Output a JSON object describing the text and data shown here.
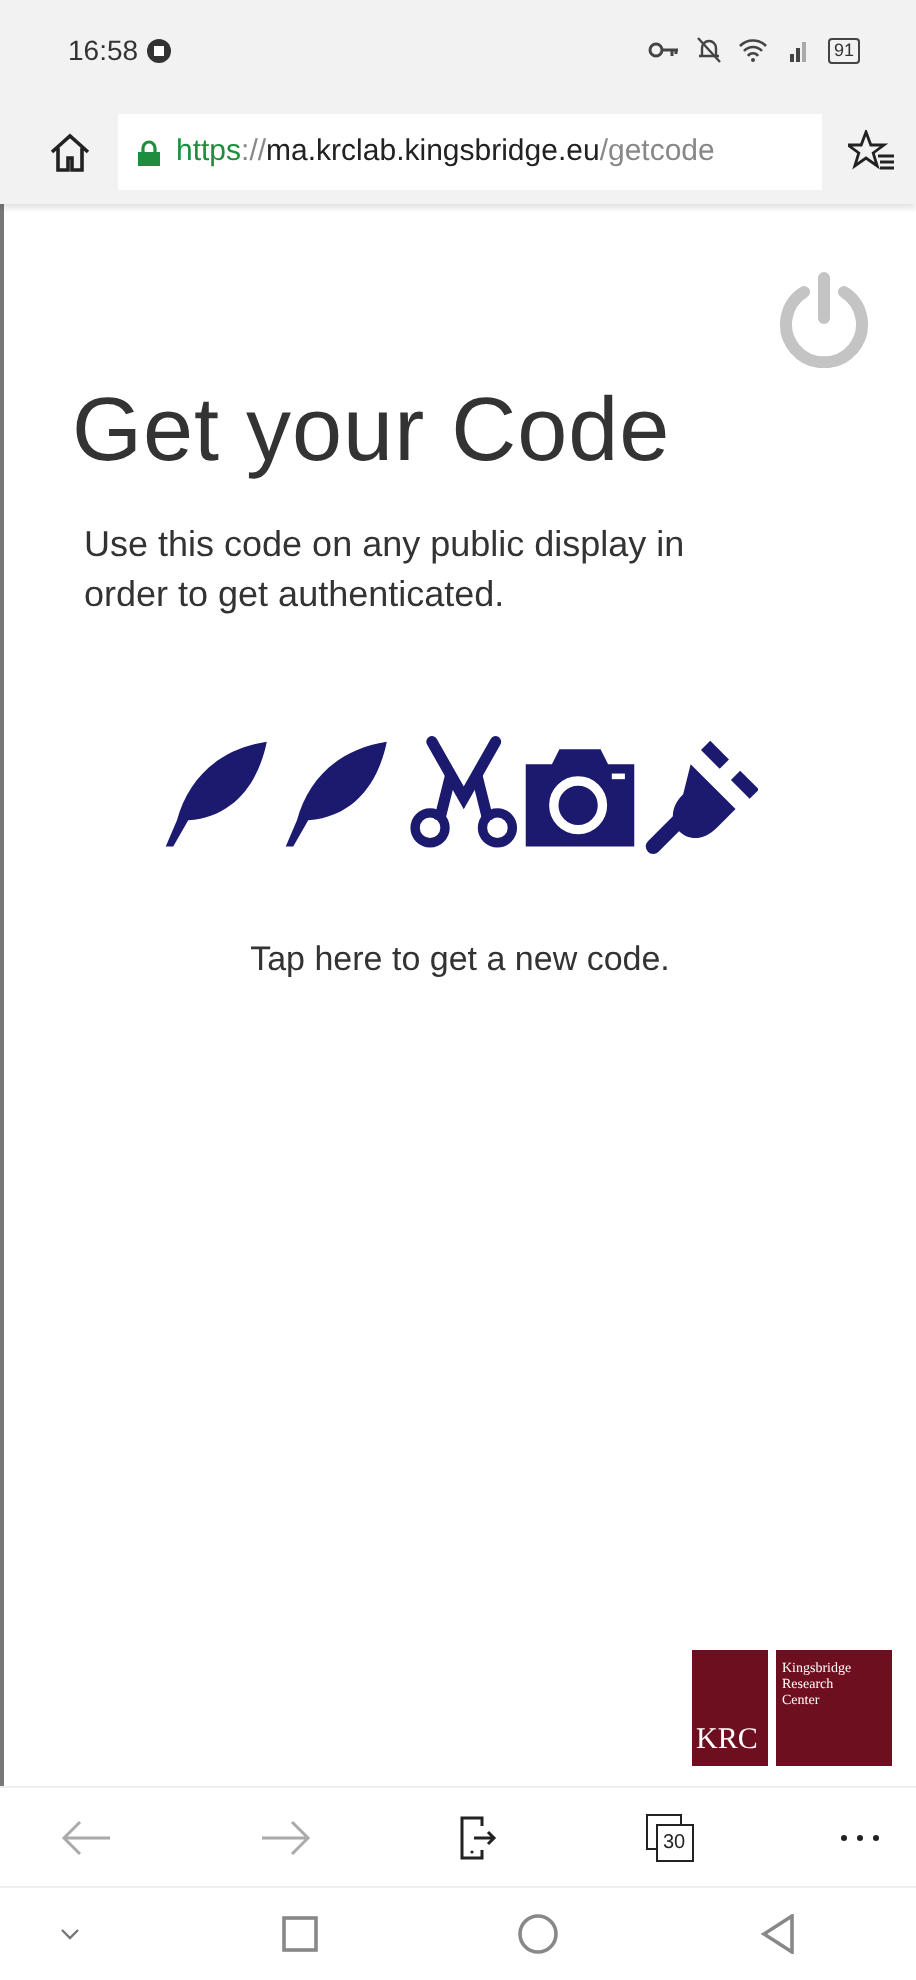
{
  "status_bar": {
    "time": "16:58",
    "battery": "91"
  },
  "address_bar": {
    "url_parts": [
      {
        "kind": "scheme",
        "text": "https"
      },
      {
        "kind": "sep",
        "text": "://"
      },
      {
        "kind": "host",
        "text": "ma.krclab.kingsbridge.eu"
      },
      {
        "kind": "path",
        "text": "/getcode"
      }
    ]
  },
  "page": {
    "title": "Get your Code",
    "description": "Use this code on any public display in order to get authenticated.",
    "code_icons": [
      {
        "kind": "feather"
      },
      {
        "kind": "feather"
      },
      {
        "kind": "scissors"
      },
      {
        "kind": "camera"
      },
      {
        "kind": "plug"
      }
    ],
    "new_code_link": "Tap here to get a new code.",
    "logo": {
      "mark": "KRC",
      "lines": [
        "Kingsbridge",
        "Research",
        "Center"
      ]
    }
  },
  "toolbar": {
    "tab_count": "30"
  }
}
